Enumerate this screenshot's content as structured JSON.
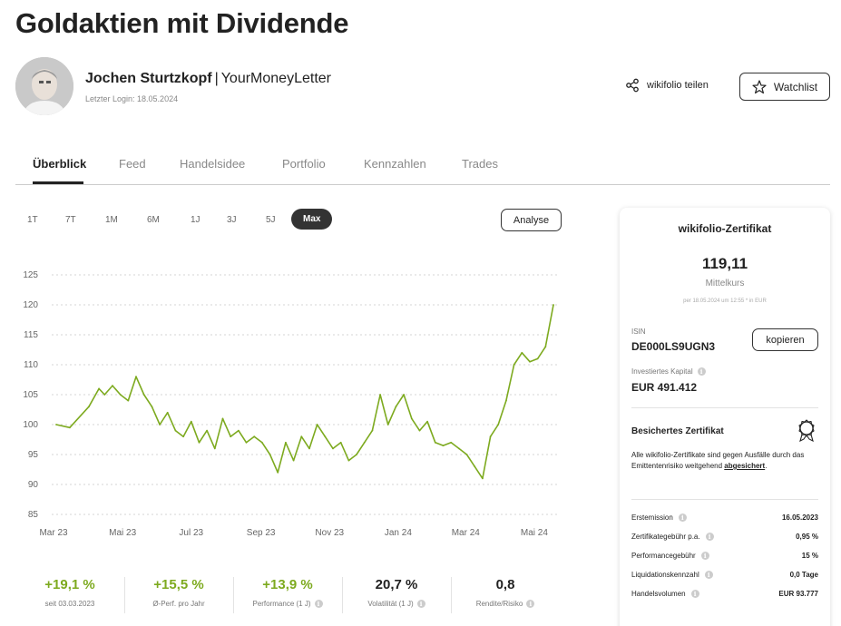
{
  "page": {
    "title": "Goldaktien mit Dividende"
  },
  "author": {
    "name": "Jochen Sturtzkopf",
    "separator": "|",
    "org": "YourMoneyLetter",
    "last_login": "Letzter Login: 18.05.2024"
  },
  "actions": {
    "share_label": "wikifolio teilen",
    "watchlist_label": "Watchlist"
  },
  "tabs": [
    {
      "label": "Überblick",
      "active": true
    },
    {
      "label": "Feed"
    },
    {
      "label": "Handelsidee"
    },
    {
      "label": "Portfolio"
    },
    {
      "label": "Kennzahlen"
    },
    {
      "label": "Trades"
    }
  ],
  "ranges": [
    {
      "label": "1T"
    },
    {
      "label": "7T"
    },
    {
      "label": "1M"
    },
    {
      "label": "6M"
    },
    {
      "label": "1J"
    },
    {
      "label": "3J"
    },
    {
      "label": "5J"
    },
    {
      "label": "Max",
      "active": true
    }
  ],
  "analyse_label": "Analyse",
  "chart_data": {
    "type": "line",
    "title": "",
    "xlabel": "",
    "ylabel": "",
    "x_ticks": [
      "Mar 23",
      "Mai 23",
      "Jul 23",
      "Sep 23",
      "Nov 23",
      "Jan 24",
      "Mar 24",
      "Mai 24"
    ],
    "y_ticks": [
      85,
      90,
      95,
      100,
      105,
      110,
      115,
      120,
      125
    ],
    "ylim": [
      85,
      125
    ],
    "x": [
      "2023-03-03",
      "2023-03-15",
      "2023-04-01",
      "2023-04-10",
      "2023-04-15",
      "2023-04-22",
      "2023-04-29",
      "2023-05-06",
      "2023-05-13",
      "2023-05-20",
      "2023-05-27",
      "2023-06-03",
      "2023-06-10",
      "2023-06-17",
      "2023-06-24",
      "2023-07-01",
      "2023-07-08",
      "2023-07-15",
      "2023-07-22",
      "2023-07-29",
      "2023-08-05",
      "2023-08-12",
      "2023-08-19",
      "2023-08-26",
      "2023-09-02",
      "2023-09-09",
      "2023-09-16",
      "2023-09-23",
      "2023-09-30",
      "2023-10-07",
      "2023-10-14",
      "2023-10-21",
      "2023-10-28",
      "2023-11-04",
      "2023-11-11",
      "2023-11-18",
      "2023-11-25",
      "2023-12-02",
      "2023-12-09",
      "2023-12-16",
      "2023-12-23",
      "2023-12-30",
      "2024-01-06",
      "2024-01-13",
      "2024-01-20",
      "2024-01-27",
      "2024-02-03",
      "2024-02-10",
      "2024-02-17",
      "2024-02-24",
      "2024-03-02",
      "2024-03-09",
      "2024-03-16",
      "2024-03-23",
      "2024-03-30",
      "2024-04-06",
      "2024-04-13",
      "2024-04-20",
      "2024-04-27",
      "2024-05-04",
      "2024-05-11",
      "2024-05-18"
    ],
    "series": [
      {
        "values": [
          100,
          99.5,
          103,
          106,
          105,
          106.5,
          105,
          104,
          108,
          105,
          103,
          100,
          102,
          99,
          98,
          100.5,
          97,
          99,
          96,
          101,
          98,
          99,
          97,
          98,
          97,
          95,
          92,
          97,
          94,
          98,
          96,
          100,
          98,
          96,
          97,
          94,
          95,
          97,
          99,
          105,
          100,
          103,
          105,
          101,
          99,
          100.5,
          97,
          96.5,
          97,
          96,
          95,
          93,
          91,
          98,
          100,
          104,
          110,
          112,
          110.5,
          111,
          113,
          120
        ],
        "color": "#7daa1f"
      }
    ],
    "grid": "horizontal-dotted"
  },
  "stats": [
    {
      "value": "+19,1 %",
      "label": "seit 03.03.2023",
      "green": true
    },
    {
      "value": "+15,5 %",
      "label": "Ø-Perf. pro Jahr",
      "green": true
    },
    {
      "value": "+13,9 %",
      "label": "Performance (1 J)",
      "green": true,
      "info": true
    },
    {
      "value": "20,7 %",
      "label": "Volatilität (1 J)",
      "info": true
    },
    {
      "value": "0,8",
      "label": "Rendite/Risiko",
      "info": true
    }
  ],
  "certificate": {
    "header": "wikifolio-Zertifikat",
    "price": "119,11",
    "price_label": "Mittelkurs",
    "price_date": "per 18.05.2024 um 12:55 * in EUR",
    "isin_label": "ISIN",
    "isin": "DE000LS9UGN3",
    "copy_label": "kopieren",
    "capital_label": "Investiertes Kapital",
    "capital": "EUR 491.412",
    "secured_title": "Besichertes Zertifikat",
    "secured_text": "Alle wikifolio-Zertifikate sind gegen Ausfälle durch das Emittentenrisiko weitgehend",
    "secured_link": "abgesichert",
    "secured_end": ".",
    "rows": [
      {
        "label": "Erstemission",
        "value": "16.05.2023"
      },
      {
        "label": "Zertifikategebühr p.a.",
        "value": "0,95 %"
      },
      {
        "label": "Performancegebühr",
        "value": "15 %"
      },
      {
        "label": "Liquidationskennzahl",
        "value": "0,0 Tage"
      },
      {
        "label": "Handelsvolumen",
        "value": "EUR 93.777"
      }
    ]
  },
  "colors": {
    "accent_green": "#7daa1f",
    "text": "#222222",
    "muted": "#888888"
  }
}
